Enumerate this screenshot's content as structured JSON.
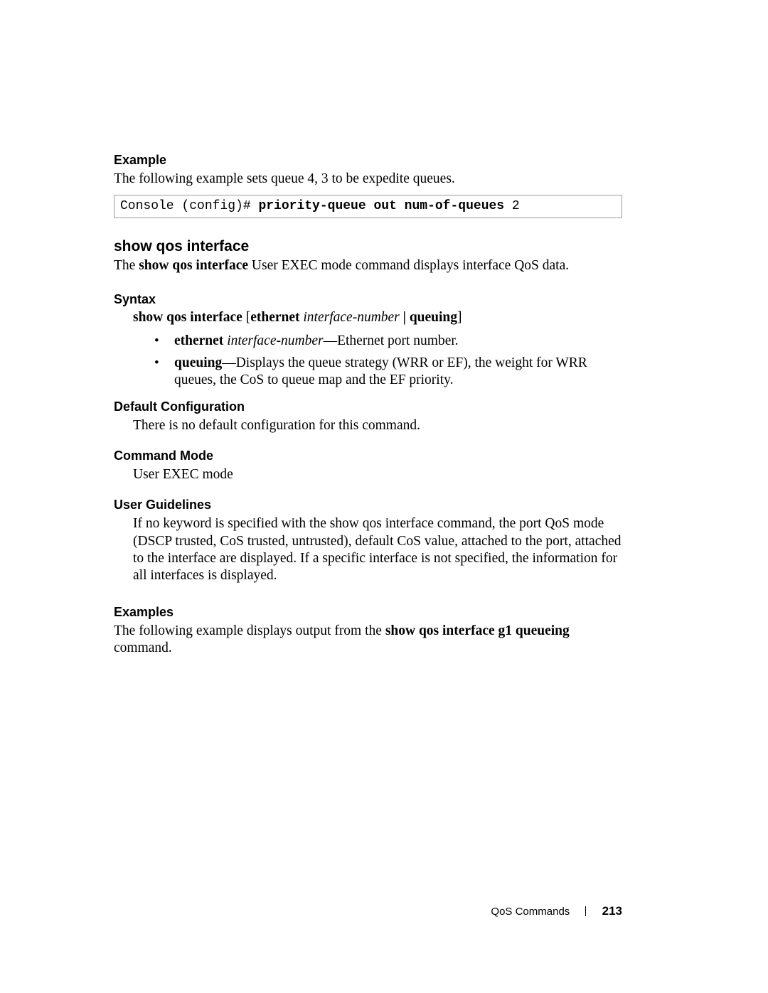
{
  "example1": {
    "heading": "Example",
    "desc": "The following example sets queue 4, 3 to be expedite queues.",
    "code_prefix": "Console (config)# ",
    "code_bold": "priority-queue out num-of-queues",
    "code_suffix": " 2"
  },
  "cmd": {
    "title": "show qos interface",
    "intro_pre": "The ",
    "intro_bold": "show qos interface",
    "intro_post": " User EXEC mode command displays interface QoS data."
  },
  "syntax": {
    "heading": "Syntax",
    "line_b1": "show qos interface ",
    "line_br1": "[",
    "line_b2": "ethernet ",
    "line_it": "interface-number",
    "line_sep": " | ",
    "line_b3": "queuing",
    "line_br2": "]",
    "bullets": [
      {
        "b": "ethernet ",
        "it": "interface-number",
        "rest": "—Ethernet port number."
      },
      {
        "b": "queuing",
        "it": "",
        "rest": "—Displays the queue strategy (WRR or EF), the weight for WRR queues, the CoS to queue map and the EF priority."
      }
    ]
  },
  "defcfg": {
    "heading": "Default Configuration",
    "body": "There is no default configuration for this command."
  },
  "cmdmode": {
    "heading": "Command Mode",
    "body": "User EXEC mode"
  },
  "userg": {
    "heading": "User Guidelines",
    "body": "If no keyword is specified with the show qos interface command, the port QoS mode (DSCP trusted, CoS trusted, untrusted), default CoS value, attached to the port, attached to the interface are displayed. If a specific interface is not specified, the information for all interfaces is displayed."
  },
  "examples2": {
    "heading": "Examples",
    "pre": "The following example displays output from the ",
    "bold": "show qos interface g1 queueing",
    "post": " command."
  },
  "footer": {
    "section": "QoS Commands",
    "page": "213"
  }
}
